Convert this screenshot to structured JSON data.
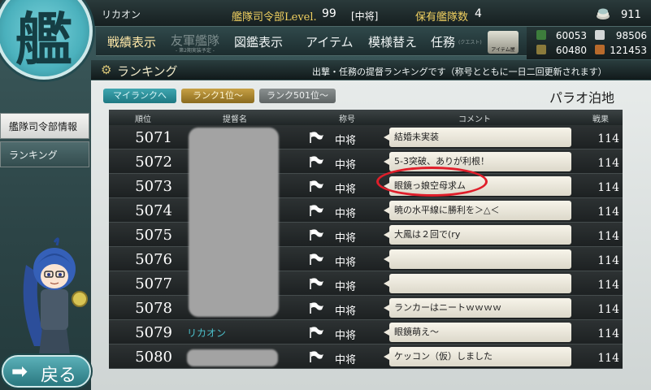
{
  "topbar": {
    "admiral_name": "リカオン",
    "level_label": "艦隊司令部Level.",
    "level_value": "99",
    "rank_tag": "[中将]",
    "ship_count_label": "保有艦隊数",
    "ship_count_value": "4",
    "coin_count": "911"
  },
  "nav": {
    "items": [
      {
        "label": "戦績表示",
        "state": "active"
      },
      {
        "label": "友軍艦隊",
        "state": "disabled",
        "sub": "- 第2期実装予定 -"
      },
      {
        "label": "図鑑表示",
        "state": "normal"
      },
      {
        "label": "アイテム",
        "state": "normal"
      },
      {
        "label": "模様替え",
        "state": "normal"
      },
      {
        "label": "任務",
        "state": "normal",
        "sub": "(クエスト)"
      }
    ],
    "item_shop_label": "アイテム屋"
  },
  "resources": {
    "fuel": "60053",
    "ammo": "60480",
    "steel": "98506",
    "bauxite": "121453"
  },
  "ranking": {
    "title": "ランキング",
    "note": "出撃・任務の提督ランキングです（称号とともに一日二回更新されます）",
    "filters": {
      "my": "マイランクへ",
      "top": "ランク1位～",
      "rank501": "ランク501位～"
    },
    "server_name": "パラオ泊地",
    "columns": {
      "rank": "順位",
      "admiral": "提督名",
      "title": "称号",
      "comment": "コメント",
      "score": "戦果"
    },
    "rows": [
      {
        "rank": "5071",
        "name": "",
        "title": "中将",
        "comment": "結婚未実装",
        "score": "114"
      },
      {
        "rank": "5072",
        "name": "",
        "title": "中将",
        "comment": "5-3突破、ありが利根！",
        "score": "114"
      },
      {
        "rank": "5073",
        "name": "",
        "title": "中将",
        "comment": "眼鏡っ娘空母求ム",
        "score": "114"
      },
      {
        "rank": "5074",
        "name": "",
        "title": "中将",
        "comment": "暁の水平線に勝利を＞△＜",
        "score": "114"
      },
      {
        "rank": "5075",
        "name": "",
        "title": "中将",
        "comment": "大鳳は２回で(ry",
        "score": "114"
      },
      {
        "rank": "5076",
        "name": "",
        "title": "中将",
        "comment": "",
        "score": "114"
      },
      {
        "rank": "5077",
        "name": "",
        "title": "中将",
        "comment": "",
        "score": "114"
      },
      {
        "rank": "5078",
        "name": "",
        "title": "中将",
        "comment": "ランカーはニートｗｗｗｗ",
        "score": "114"
      },
      {
        "rank": "5079",
        "name": "リカオン",
        "title": "中将",
        "comment": "眼鏡萌え～",
        "score": "114"
      },
      {
        "rank": "5080",
        "name": "",
        "title": "中将",
        "comment": "ケッコン（仮）しました",
        "score": "114"
      }
    ]
  },
  "side_menu": {
    "hq_info": "艦隊司令部情報",
    "ranking": "ランキング"
  },
  "back_button": {
    "label": "戻る"
  },
  "emblem": {
    "glyph": "艦"
  },
  "colors": {
    "accent_teal": "#3fa6b0",
    "accent_gold": "#c7a044",
    "admiral_name": "#4cc1cc",
    "highlight_red": "#e01e2a"
  }
}
